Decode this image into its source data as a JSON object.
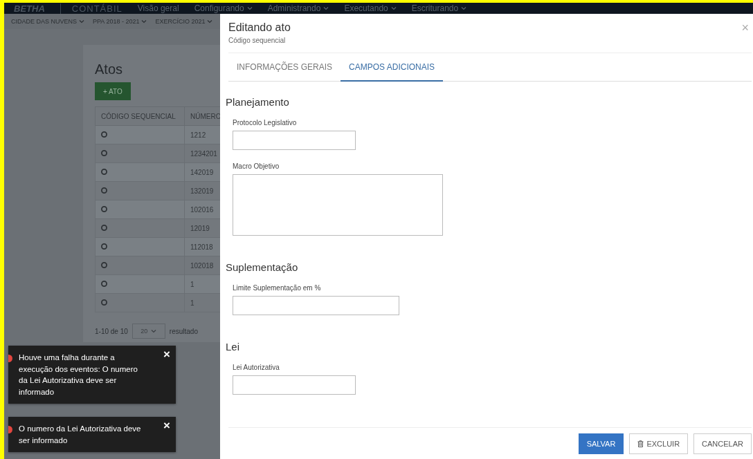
{
  "top_nav": {
    "brand": "BETHA",
    "product": "CONTÁBIL",
    "items": [
      {
        "label": "Visão geral",
        "has_menu": false
      },
      {
        "label": "Configurando",
        "has_menu": true
      },
      {
        "label": "Administrando",
        "has_menu": true
      },
      {
        "label": "Executando",
        "has_menu": true
      },
      {
        "label": "Escriturando",
        "has_menu": true
      }
    ]
  },
  "context_bar": {
    "items": [
      {
        "label": "CIDADE DAS NUVENS",
        "has_menu": true
      },
      {
        "label": "PPA 2018 - 2021",
        "has_menu": true
      },
      {
        "label": "EXERCÍCIO 2021",
        "has_menu": true
      }
    ]
  },
  "page": {
    "title": "Atos",
    "add_button": "+ ATO",
    "table": {
      "columns": [
        "CÓDIGO SEQUENCIAL",
        "NÚMERO"
      ],
      "rows": [
        {
          "number": "1212"
        },
        {
          "number": "1234201"
        },
        {
          "number": "142019"
        },
        {
          "number": "132019"
        },
        {
          "number": "102016"
        },
        {
          "number": "12019"
        },
        {
          "number": "112018"
        },
        {
          "number": "102018"
        },
        {
          "number": "1"
        },
        {
          "number": "1"
        }
      ]
    },
    "pagination": {
      "range": "1-10 de 10",
      "page_size": "20",
      "suffix": "resultado"
    }
  },
  "toasts": [
    {
      "message": "Houve uma falha durante a execução dos eventos: O numero da Lei Autorizativa deve ser informado",
      "close": "×"
    },
    {
      "message": "O numero da Lei Autorizativa deve ser informado",
      "close": "×"
    }
  ],
  "modal": {
    "title": "Editando ato",
    "subtitle": "Código sequencial",
    "close": "×",
    "tabs": [
      {
        "label": "INFORMAÇÕES GERAIS",
        "selected": false
      },
      {
        "label": "CAMPOS ADICIONAIS",
        "selected": true
      }
    ],
    "sections": [
      {
        "title": "Planejamento",
        "fields": [
          {
            "label": "Protocolo Legislativo",
            "kind": "input"
          },
          {
            "label": "Macro Objetivo",
            "kind": "textarea"
          }
        ]
      },
      {
        "title": "Suplementação",
        "fields": [
          {
            "label": "Limite Suplementação em %",
            "kind": "input"
          }
        ]
      },
      {
        "title": "Lei",
        "fields": [
          {
            "label": "Lei Autorizativa",
            "kind": "input"
          }
        ]
      }
    ],
    "buttons": [
      {
        "label": "SALVAR",
        "kind": "primary"
      },
      {
        "label": "EXCLUIR",
        "kind": "delete"
      },
      {
        "label": "CANCELAR",
        "kind": "default"
      }
    ]
  }
}
